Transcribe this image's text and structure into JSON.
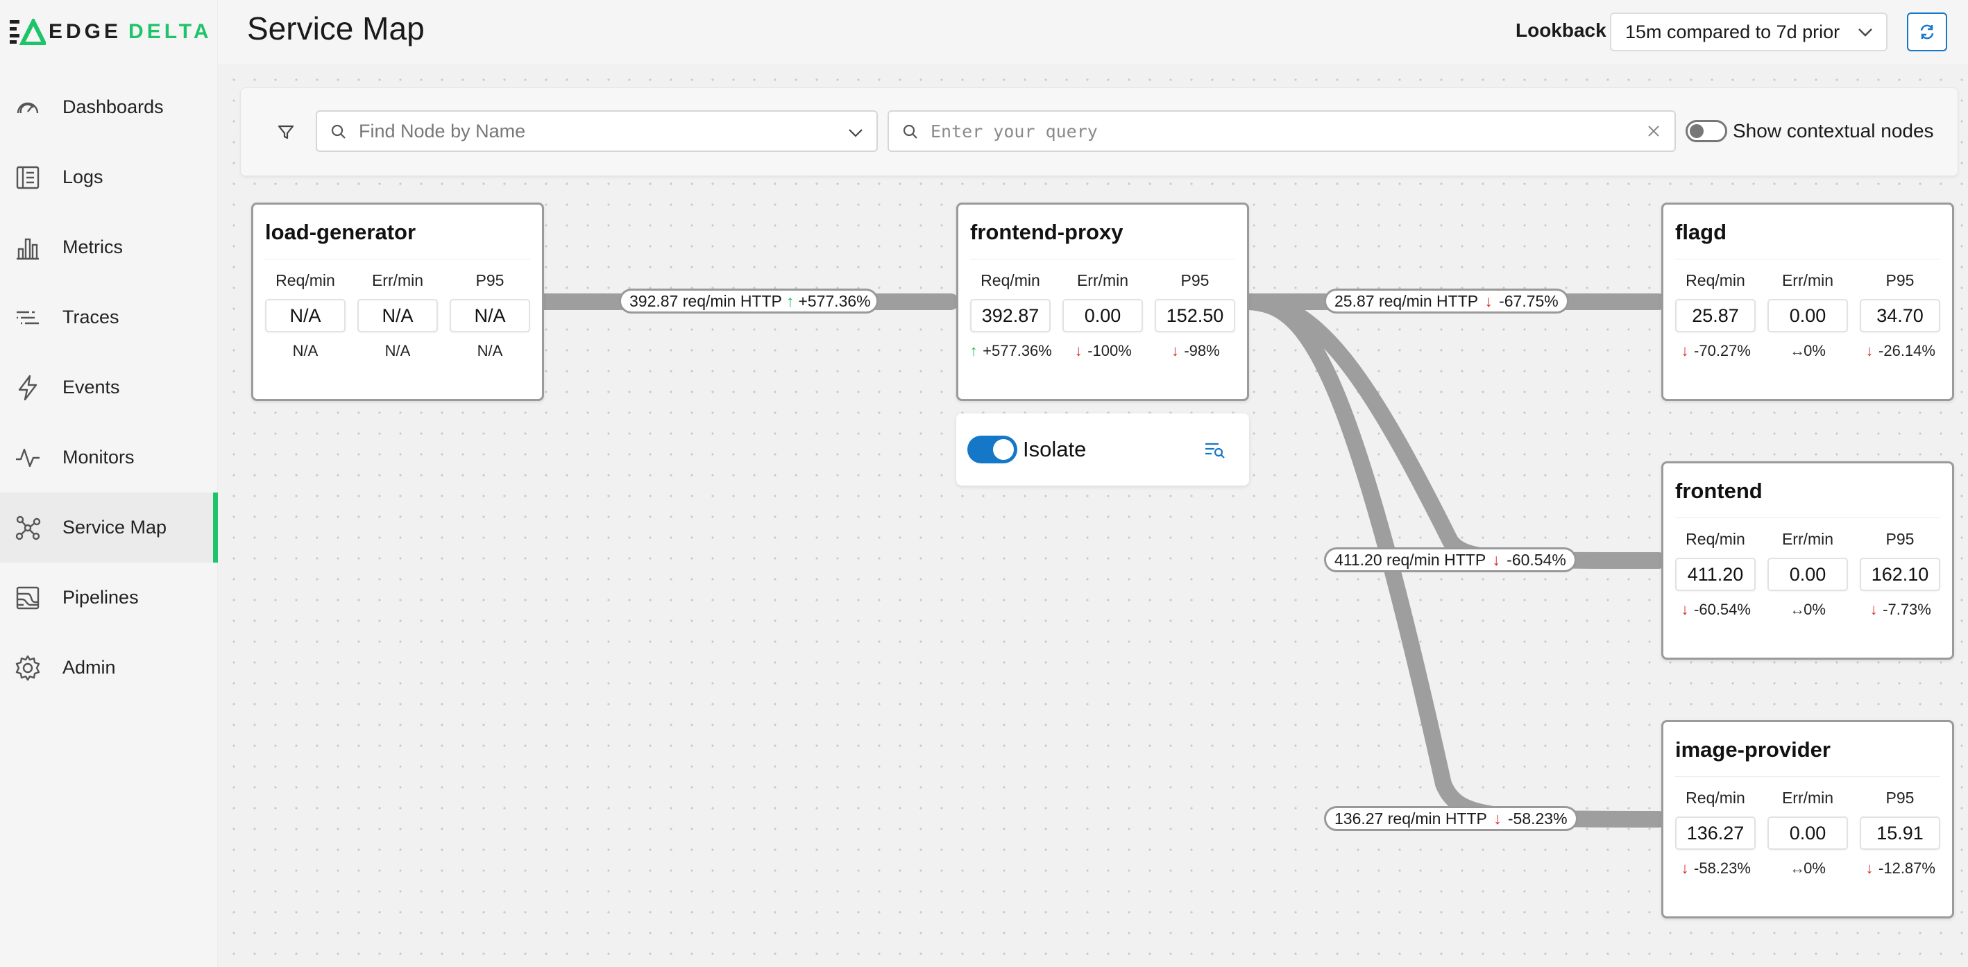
{
  "brand": {
    "name_left": "EDGE",
    "name_right": "DELTA",
    "accent": "#1fc46a"
  },
  "sidebar": {
    "items": [
      {
        "label": "Dashboards",
        "icon": "gauge-icon"
      },
      {
        "label": "Logs",
        "icon": "log-list-icon"
      },
      {
        "label": "Metrics",
        "icon": "bar-chart-icon"
      },
      {
        "label": "Traces",
        "icon": "traces-icon"
      },
      {
        "label": "Events",
        "icon": "lightning-icon"
      },
      {
        "label": "Monitors",
        "icon": "pulse-icon"
      },
      {
        "label": "Service Map",
        "icon": "service-map-icon",
        "active": true
      },
      {
        "label": "Pipelines",
        "icon": "pipelines-icon"
      },
      {
        "label": "Admin",
        "icon": "gear-icon"
      }
    ]
  },
  "header": {
    "title": "Service Map",
    "lookback_label": "Lookback",
    "lookback_value": "15m compared to 7d prior"
  },
  "filters": {
    "node_search_placeholder": "Find Node by Name",
    "query_placeholder": "Enter your query",
    "contextual_label": "Show contextual nodes",
    "contextual_on": false
  },
  "edges": [
    {
      "rate": "392.87 req/min HTTP",
      "dir": "up",
      "change": "+577.36%"
    },
    {
      "rate": "25.87 req/min HTTP",
      "dir": "down",
      "change": "-67.75%"
    },
    {
      "rate": "411.20 req/min HTTP",
      "dir": "down",
      "change": "-60.54%"
    },
    {
      "rate": "136.27 req/min HTTP",
      "dir": "down",
      "change": "-58.23%"
    }
  ],
  "metric_headers": {
    "req": "Req/min",
    "err": "Err/min",
    "p95": "P95"
  },
  "nodes": [
    {
      "name": "load-generator",
      "req": "N/A",
      "err": "N/A",
      "p95": "N/A",
      "req_delta": "N/A",
      "err_delta": "N/A",
      "p95_delta": "N/A",
      "req_dir": "none",
      "err_dir": "none",
      "p95_dir": "none"
    },
    {
      "name": "frontend-proxy",
      "req": "392.87",
      "err": "0.00",
      "p95": "152.50",
      "req_delta": "+577.36%",
      "err_delta": "-100%",
      "p95_delta": "-98%",
      "req_dir": "up",
      "err_dir": "down",
      "p95_dir": "down"
    },
    {
      "name": "flagd",
      "req": "25.87",
      "err": "0.00",
      "p95": "34.70",
      "req_delta": "-70.27%",
      "err_delta": "0%",
      "p95_delta": "-26.14%",
      "req_dir": "down",
      "err_dir": "neutral",
      "p95_dir": "down"
    },
    {
      "name": "frontend",
      "req": "411.20",
      "err": "0.00",
      "p95": "162.10",
      "req_delta": "-60.54%",
      "err_delta": "0%",
      "p95_delta": "-7.73%",
      "req_dir": "down",
      "err_dir": "neutral",
      "p95_dir": "down"
    },
    {
      "name": "image-provider",
      "req": "136.27",
      "err": "0.00",
      "p95": "15.91",
      "req_delta": "-58.23%",
      "err_delta": "0%",
      "p95_delta": "-12.87%",
      "req_dir": "down",
      "err_dir": "neutral",
      "p95_dir": "down"
    }
  ],
  "isolate": {
    "label": "Isolate",
    "on": true
  },
  "colors": {
    "up": "#1fb860",
    "down": "#d62828",
    "toggle": "#1577c8",
    "edge": "#9e9e9e"
  }
}
